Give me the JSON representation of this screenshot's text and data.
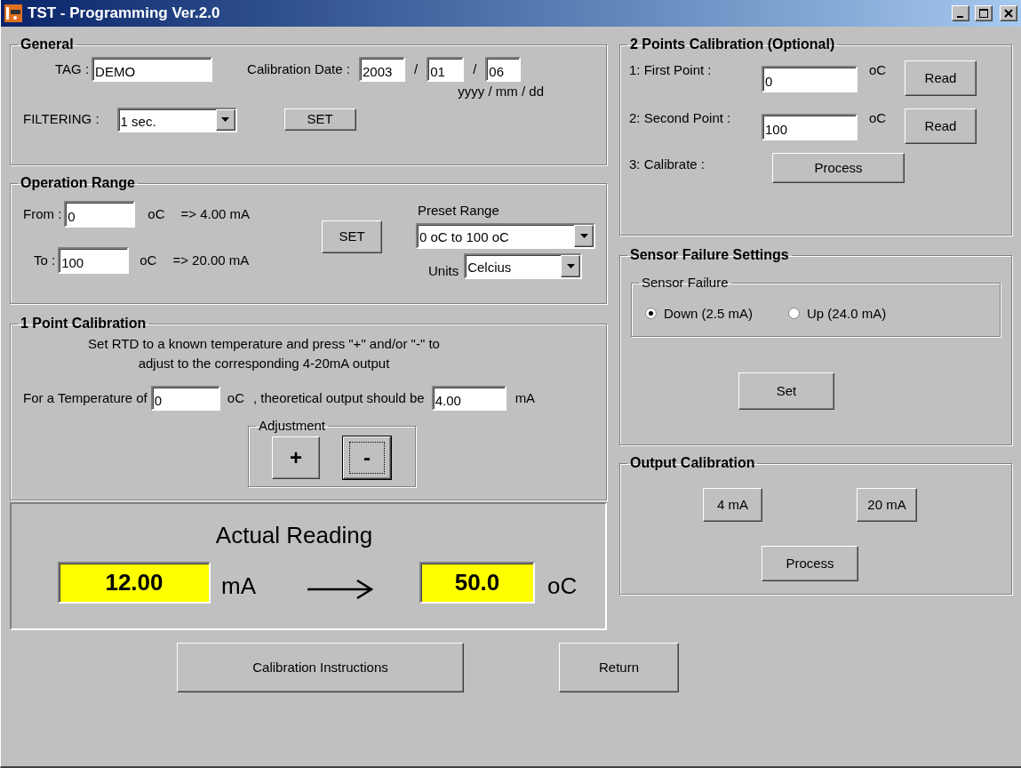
{
  "window": {
    "title": "TST - Programming Ver.2.0"
  },
  "general": {
    "title": "General",
    "tag_label": "TAG :",
    "tag_value": "DEMO",
    "date_label": "Calibration Date :",
    "year": "2003",
    "separator_1": "/",
    "month": "01",
    "separator_2": "/",
    "day": "06",
    "date_format": "yyyy / mm / dd",
    "filtering_label": "FILTERING :",
    "filtering_value": "1 sec.",
    "set_button": "SET"
  },
  "operation_range": {
    "title": "Operation Range",
    "from_label": "From :",
    "from_value": "0",
    "from_unit": "oC",
    "from_output": "=> 4.00 mA",
    "to_label": "To :",
    "to_value": "100",
    "to_unit": "oC",
    "to_output": "=> 20.00 mA",
    "set_button": "SET",
    "preset_label": "Preset Range",
    "preset_value": "0 oC to 100 oC",
    "units_label": "Units",
    "units_value": "Celcius"
  },
  "one_point_calibration": {
    "title": "1 Point Calibration",
    "instructions": "Set RTD to a known temperature and press \"+\" and/or \"-\" to\nadjust to the corresponding 4-20mA output",
    "temperature_label": "For a Temperature of",
    "temperature_value": "0",
    "temperature_unit": "oC",
    "output_label": ", theoretical output should be",
    "output_value": "4.00",
    "output_unit": "mA",
    "adjustment": {
      "title": "Adjustment",
      "buttons": [
        {
          "label": "+",
          "focused": false
        },
        {
          "label": "-",
          "focused": true
        }
      ]
    }
  },
  "actual_reading": {
    "title": "Actual Reading",
    "current": "12.00",
    "current_unit": "mA",
    "temperature": "50.0",
    "temperature_unit": "oC"
  },
  "footer_buttons": [
    "Calibration Instructions",
    "Return"
  ],
  "two_points_calibration": {
    "title": "2 Points Calibration (Optional)",
    "rows": [
      {
        "label": "1: First Point :",
        "value": "0",
        "unit": "oC",
        "button": "Read"
      },
      {
        "label": "2: Second Point :",
        "value": "100",
        "unit": "oC",
        "button": "Read"
      }
    ],
    "calibrate_label": "3: Calibrate :",
    "process_button": "Process"
  },
  "sensor_failure_settings": {
    "title": "Sensor Failure Settings",
    "group_title": "Sensor Failure",
    "options": [
      {
        "label": "Down (2.5 mA)",
        "selected": true
      },
      {
        "label": "Up (24.0 mA)",
        "selected": false
      }
    ],
    "set_button": "Set"
  },
  "output_calibration": {
    "title": "Output Calibration",
    "buttons": [
      "4 mA",
      "20 mA"
    ],
    "process_button": "Process"
  }
}
